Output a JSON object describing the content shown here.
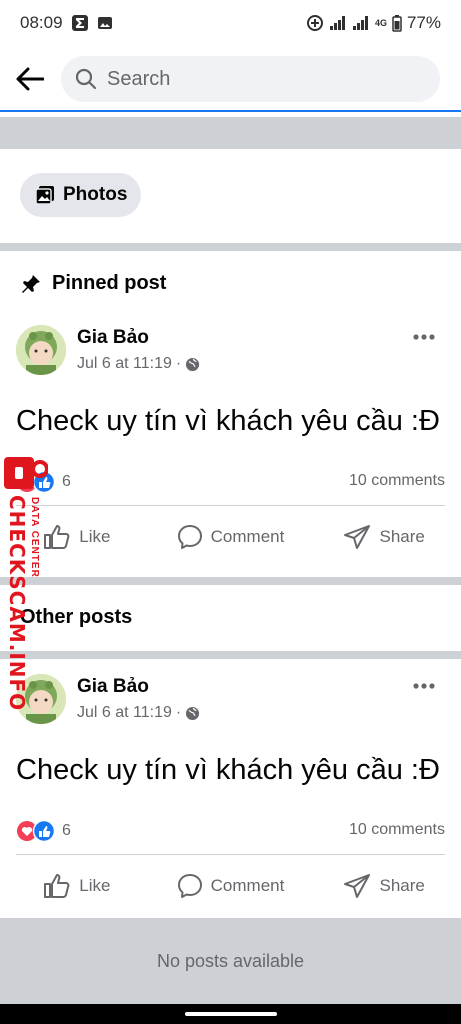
{
  "status_bar": {
    "time": "08:09",
    "battery": "77%",
    "network": "4G"
  },
  "search": {
    "placeholder": "Search"
  },
  "chips": {
    "photos_label": "Photos"
  },
  "sections": {
    "pinned_title": "Pinned post",
    "other_title": "Other posts"
  },
  "posts": [
    {
      "author": "Gia Bảo",
      "timestamp": "Jul 6 at 11:19",
      "separator": "·",
      "text": "Check uy tín vì khách yêu cầu :Đ",
      "reaction_count": "6",
      "comments": "10 comments",
      "actions": {
        "like": "Like",
        "comment": "Comment",
        "share": "Share"
      }
    },
    {
      "author": "Gia Bảo",
      "timestamp": "Jul 6 at 11:19",
      "separator": "·",
      "text": "Check uy tín vì khách yêu cầu :Đ",
      "reaction_count": "6",
      "comments": "10 comments",
      "actions": {
        "like": "Like",
        "comment": "Comment",
        "share": "Share"
      }
    }
  ],
  "empty_state": "No posts available",
  "watermark": {
    "brand": "CHECKSCAM.INFO",
    "sub": "DATA CENTER"
  },
  "colors": {
    "accent": "#1877f2",
    "like_blue": "#1877f2",
    "love_red": "#f33e58",
    "watermark_red": "#e0161e"
  }
}
